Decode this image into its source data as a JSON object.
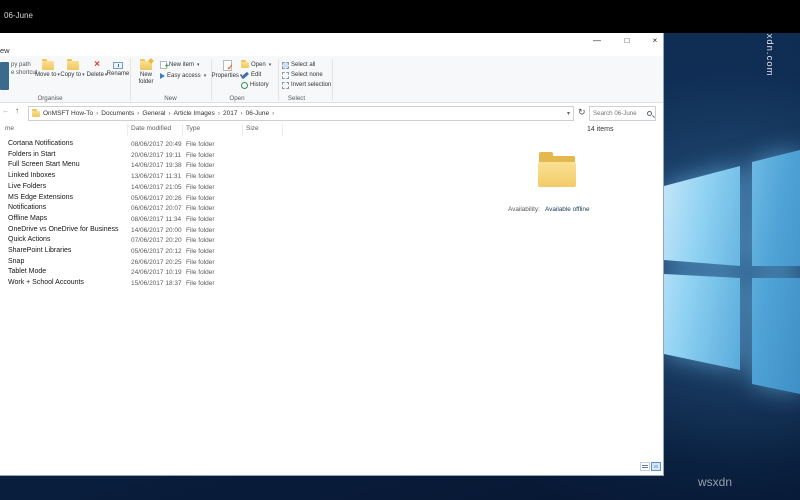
{
  "topbar": {
    "title": "06-June"
  },
  "watermarks": {
    "side": "wsxdn.com",
    "bottom": "wsxdn"
  },
  "icons": {
    "minimize": "—",
    "maximize": "□",
    "close": "×",
    "delete": "×",
    "dropdown": "▾",
    "up_arrow": "↑",
    "back_arrow": "←",
    "refresh": "↻",
    "crumb_separator": "›",
    "check": "✓",
    "plus": "+"
  },
  "window": {
    "ribbon_tab_partial": "ew",
    "ribbon": {
      "clipped_copy_path": "py path",
      "clipped_paste_shortcut": "e shortcut",
      "groups": [
        {
          "label": "Organise",
          "buttons": [
            "Move to",
            "Copy to",
            "Delete",
            "Rename"
          ]
        },
        {
          "label": "New",
          "buttons": [
            "New folder",
            "New item",
            "Easy access"
          ]
        },
        {
          "label": "Open",
          "buttons": [
            "Properties",
            "Open",
            "Edit",
            "History"
          ]
        },
        {
          "label": "Select",
          "buttons": [
            "Select all",
            "Select none",
            "Invert selection"
          ]
        }
      ]
    },
    "address": {
      "crumbs": [
        "OnMSFT How-To",
        "Documents",
        "General",
        "Article Images",
        "2017",
        "06-June"
      ],
      "search_placeholder": "Search 06-June"
    },
    "columns": {
      "name_partial": "me",
      "date": "Date modified",
      "type": "Type",
      "size": "Size"
    },
    "items": [
      {
        "name": "Cortana Notifications",
        "date": "08/06/2017 20:49",
        "type": "File folder"
      },
      {
        "name": "Folders in Start",
        "date": "20/06/2017 19:11",
        "type": "File folder"
      },
      {
        "name": "Full Screen Start Menu",
        "date": "14/06/2017 19:38",
        "type": "File folder"
      },
      {
        "name": "Linked Inboxes",
        "date": "13/06/2017 11:31",
        "type": "File folder"
      },
      {
        "name": "Live Folders",
        "date": "14/06/2017 21:05",
        "type": "File folder"
      },
      {
        "name": "MS Edge Extensions",
        "date": "05/06/2017 20:26",
        "type": "File folder"
      },
      {
        "name": "Notifications",
        "date": "06/06/2017 20:07",
        "type": "File folder"
      },
      {
        "name": "Offline Maps",
        "date": "08/06/2017 11:34",
        "type": "File folder"
      },
      {
        "name": "OneDrive vs OneDrive for Business",
        "date": "14/06/2017 20:00",
        "type": "File folder"
      },
      {
        "name": "Quick Actions",
        "date": "07/06/2017 20:20",
        "type": "File folder"
      },
      {
        "name": "SharePoint Libraries",
        "date": "05/06/2017 20:12",
        "type": "File folder"
      },
      {
        "name": "Snap",
        "date": "26/06/2017 20:25",
        "type": "File folder"
      },
      {
        "name": "Tablet Mode",
        "date": "24/06/2017 10:19",
        "type": "File folder"
      },
      {
        "name": "Work + School Accounts",
        "date": "15/06/2017 18:37",
        "type": "File folder"
      }
    ],
    "details": {
      "count": "14 items",
      "availability_label": "Availability:",
      "availability_value": "Available offline"
    }
  }
}
